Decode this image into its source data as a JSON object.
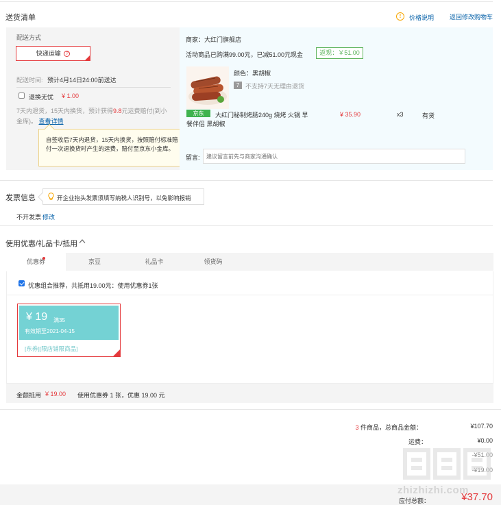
{
  "header": {
    "title": "送货清单",
    "price_note": "价格说明",
    "back_to_cart": "返回修改购物车"
  },
  "delivery": {
    "method_label": "配送方式",
    "method_value": "快递运输",
    "time_label": "配送时间:",
    "time_value": "预计4月14日24:00前送达",
    "return_option": "退换无忧",
    "return_price": "¥ 1.00",
    "return_desc_1": "7天内退货，15天内换货，预计获得",
    "return_desc_hl": "9.8",
    "return_desc_2": "元运费赔付(到小",
    "return_desc_3": "金库)。",
    "return_detail_link": "查看详情",
    "tooltip_text": "自签收后7天内退货，15天内换货，按照赔付标准赔付一次退换货时产生的运费，赔付至京东小金库。",
    "tooltip_close": "×"
  },
  "shop": {
    "merchant": "商家：大红门旗舰店",
    "promo": "活动商品已购满99.00元，已减51.00元现金",
    "rebate": "返现：￥51.00",
    "color_spec": "颜色：黑胡椒",
    "no_return_badge": "7",
    "no_return": "不支持7天无理由退货",
    "product_tag": "京东",
    "product_name_1": "大红门秘制烤肠240g 烧烤 火锅 早",
    "product_name_2": "餐伴侣 黑胡椒",
    "price": "¥ 35.90",
    "qty": "x3",
    "stock": "有货",
    "message_label": "留言:",
    "message_placeholder": "建议留言前先与商家沟通确认"
  },
  "invoice": {
    "title": "发票信息",
    "hint": "开企业抬头发票须填写纳税人识别号，以免影响报销",
    "value": "不开发票",
    "edit": "修改"
  },
  "coupon": {
    "title": "使用优惠/礼品卡/抵用",
    "tabs": [
      "优惠券",
      "京豆",
      "礼品卡",
      "领货码"
    ],
    "recommend": "优惠组合推荐，共抵用19.00元：使用优惠券1张",
    "card_amount": "¥ 19",
    "card_condition": "满35",
    "card_validity": "有效期至2021-04-15",
    "card_tag_1": "[东券]",
    "card_tag_2": "[限店铺限商品]",
    "summary_label": "金额抵用",
    "summary_amount": "¥ 19.00",
    "summary_desc": "使用优惠券 1 张，优惠 19.00 元"
  },
  "totals": {
    "count": "3",
    "count_suffix": "件商品，总商品金额：",
    "goods_amount": "¥107.70",
    "shipping_label": "运费：",
    "shipping_amount": "¥0.00",
    "discount_amount": "-¥51.00",
    "coupon_amount": "-¥19.00",
    "payable_label": "应付总额：",
    "payable_amount": "¥37.70"
  },
  "watermark": "zhizhizhi.com",
  "colors": {
    "accent_red": "#e4393c",
    "link_blue": "#005ea7",
    "coupon_teal": "#74d2d4",
    "panel_blue": "#f3fbfe",
    "panel_gray": "#f4f4f4",
    "rebate_green": "#5eb45e"
  }
}
